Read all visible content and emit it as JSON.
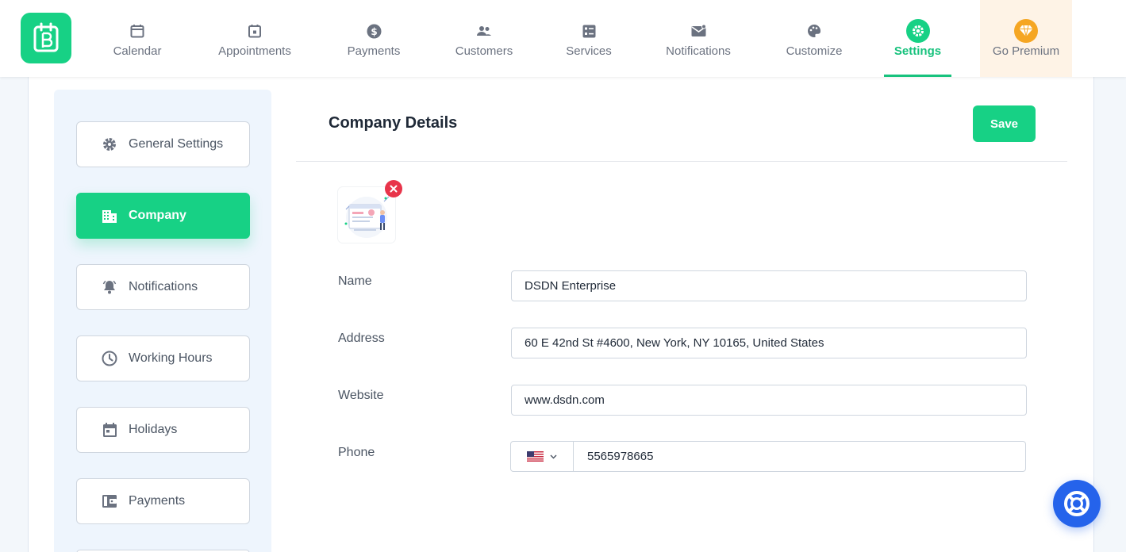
{
  "nav": {
    "items": [
      {
        "label": "Calendar",
        "icon": "calendar-icon"
      },
      {
        "label": "Appointments",
        "icon": "appointments-icon"
      },
      {
        "label": "Payments",
        "icon": "dollar-icon"
      },
      {
        "label": "Customers",
        "icon": "users-icon"
      },
      {
        "label": "Services",
        "icon": "services-icon"
      },
      {
        "label": "Notifications",
        "icon": "mail-icon"
      },
      {
        "label": "Customize",
        "icon": "palette-icon"
      },
      {
        "label": "Settings",
        "icon": "gear-icon",
        "active": true
      },
      {
        "label": "Go Premium",
        "icon": "diamond-icon"
      }
    ]
  },
  "sidebar": {
    "items": [
      {
        "label": "General Settings",
        "icon": "gear-icon"
      },
      {
        "label": "Company",
        "icon": "building-icon",
        "active": true
      },
      {
        "label": "Notifications",
        "icon": "bell-icon"
      },
      {
        "label": "Working Hours",
        "icon": "clock-icon"
      },
      {
        "label": "Holidays",
        "icon": "calendar-icon"
      },
      {
        "label": "Payments",
        "icon": "wallet-icon"
      }
    ]
  },
  "main": {
    "title": "Company Details",
    "save_label": "Save",
    "fields": {
      "name": {
        "label": "Name",
        "value": "DSDN Enterprise"
      },
      "address": {
        "label": "Address",
        "value": "60 E 42nd St #4600, New York, NY 10165, United States"
      },
      "website": {
        "label": "Website",
        "value": "www.dsdn.com"
      },
      "phone": {
        "label": "Phone",
        "value": "5565978665",
        "country_flag": "us-flag-icon"
      }
    }
  },
  "colors": {
    "accent": "#17d185",
    "active_text": "#17c27d",
    "remove": "#e8344a",
    "help": "#2563eb",
    "premium_bg": "#fef3e6",
    "premium_icon": "#f5a623"
  }
}
